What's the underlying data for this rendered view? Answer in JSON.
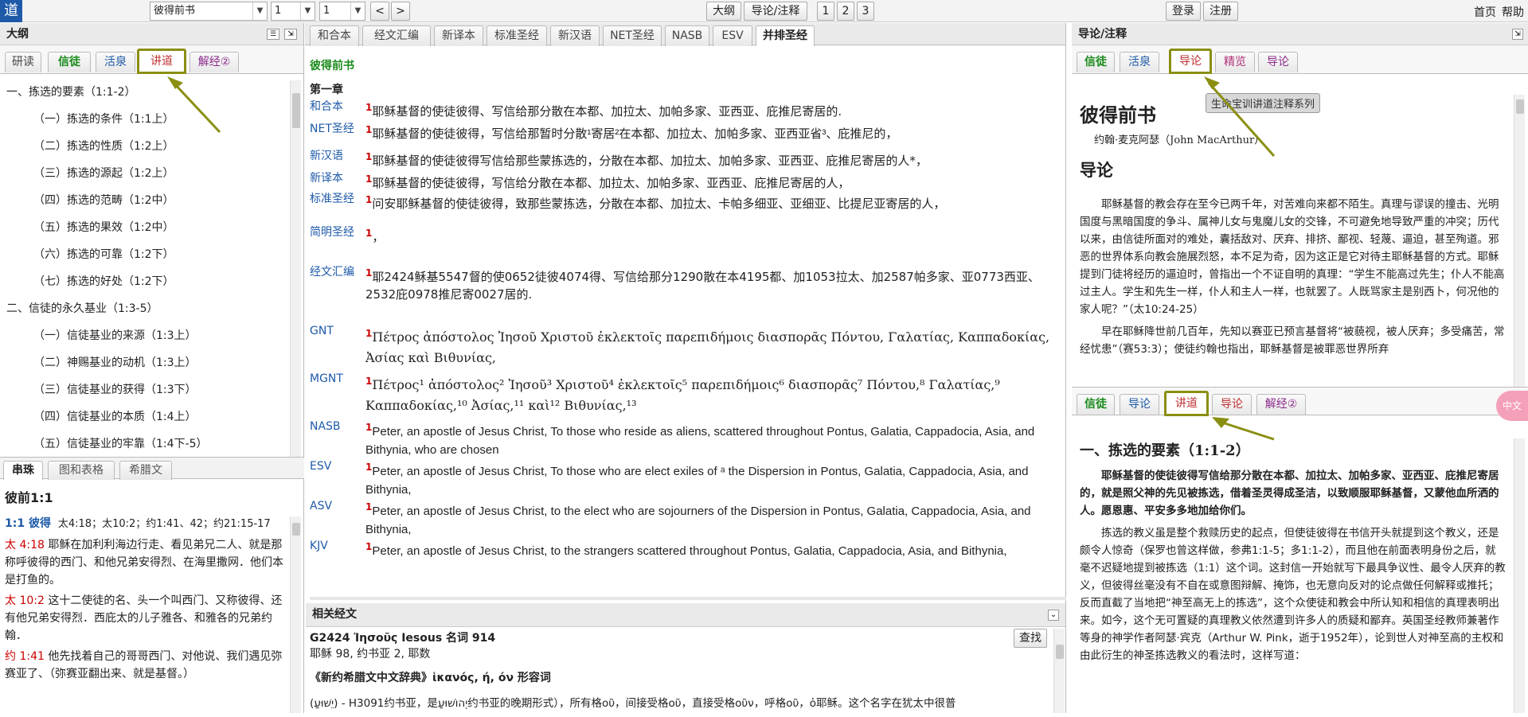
{
  "toolbar": {
    "logo": "道",
    "book": "彼得前书",
    "chapter": "1",
    "verse": "1",
    "prev": "<",
    "next": ">",
    "outline_btn": "大纲",
    "notes_btn": "导论/注释",
    "col1": "1",
    "col2": "2",
    "col3": "3",
    "login": "登录",
    "register": "注册",
    "home": "首页",
    "help": "帮助"
  },
  "left": {
    "title": "大纲",
    "tabs": [
      "研读",
      "信徒",
      "活泉",
      "讲道",
      "解经②"
    ],
    "outline": [
      "一、拣选的要素（1:1-2）",
      "（一）拣选的条件（1:1上）",
      "（二）拣选的性质（1:2上）",
      "（三）拣选的源起（1:2上）",
      "（四）拣选的范畴（1:2中）",
      "（五）拣选的果效（1:2中）",
      "（六）拣选的可靠（1:2下）",
      "（七）拣选的好处（1:2下）",
      "二、信徒的永久基业（1:3-5）",
      "（一）信徒基业的来源（1:3上）",
      "（二）神赐基业的动机（1:3上）",
      "（三）信徒基业的获得（1:3下）",
      "（四）信徒基业的本质（1:4上）",
      "（五）信徒基业的牢靠（1:4下-5）"
    ],
    "bottom_tabs": [
      "串珠",
      "图和表格",
      "希腊文"
    ],
    "cross_title": "彼前1:1",
    "cross_head_ref": "1:1 彼得",
    "cross_head_refs": "太4:18；太10:2；约1:41、42；约21:15-17",
    "cross_items": [
      {
        "ref": "太 4:18",
        "text": "耶稣在加利利海边行走、看见弟兄二人、就是那称呼彼得的西门、和他兄弟安得烈、在海里撒网．他们本是打鱼的。"
      },
      {
        "ref": "太 10:2",
        "text": "这十二使徒的名、头一个叫西门、又称彼得、还有他兄弟安得烈．西庇太的儿子雅各、和雅各的兄弟约翰．"
      },
      {
        "ref": "约 1:41",
        "text": "他先找着自己的哥哥西门、对他说、我们遇见弥赛亚了、（弥赛亚翻出来、就是基督。）"
      }
    ]
  },
  "center": {
    "tabs": [
      "和合本",
      "经文汇编",
      "新译本",
      "标准圣经",
      "新汉语",
      "NET圣经",
      "NASB",
      "ESV",
      "并排圣经"
    ],
    "book_title": "彼得前书",
    "chapter_title": "第一章",
    "verses": [
      {
        "name": "和合本",
        "text": "耶稣基督的使徒彼得、写信给那分散在本都、加拉太、加帕多家、亚西亚、庇推尼寄居的."
      },
      {
        "name": "NET圣经",
        "text": "耶稣基督的使徒彼得，写信给那暂时分散¹寄居²在本都、加拉太、加帕多家、亚西亚省³、庇推尼的，"
      },
      {
        "name": "新汉语",
        "text": "耶稣基督的使徒彼得写信给那些蒙拣选的，分散在本都、加拉太、加帕多家、亚西亚、庇推尼寄居的人*，"
      },
      {
        "name": "新译本",
        "text": "耶稣基督的使徒彼得，写信给分散在本都、加拉太、加帕多家、亚西亚、庇推尼寄居的人，"
      },
      {
        "name": "标准圣经",
        "text": "问安耶稣基督的使徒彼得，致那些蒙拣选，分散在本都、加拉太、卡帕多细亚、亚细亚、比提尼亚寄居的人，"
      },
      {
        "name": "简明圣经",
        "text": "，"
      },
      {
        "name": "经文汇编",
        "text": "耶2424稣基5547督的使0652徒彼4074得、写信给那分1290散在本4195都、加1053拉太、加2587帕多家、亚0773西亚、2532庇0978推尼寄0027居的."
      },
      {
        "name": "GNT",
        "text": "Πέτρος ἀπόστολος Ἰησοῦ Χριστοῦ ἐκλεκτοῖς παρεπιδήμοις διασπορᾶς Πόντου, Γαλατίας, Καππαδοκίας, Ἀσίας καὶ Βιθυνίας,"
      },
      {
        "name": "MGNT",
        "text": "Πέτρος¹ ἀπόστολος² Ἰησοῦ³ Χριστοῦ⁴ ἐκλεκτοῖς⁵ παρεπιδήμοις⁶ διασπορᾶς⁷ Πόντου,⁸ Γαλατίας,⁹ Καππαδοκίας,¹⁰ Ἀσίας,¹¹ καὶ¹² Βιθυνίας,¹³"
      },
      {
        "name": "NASB",
        "text": "Peter, an apostle of Jesus Christ, To those who reside as aliens, scattered throughout Pontus, Galatia, Cappadocia, Asia, and Bithynia, who are chosen"
      },
      {
        "name": "ESV",
        "text": "Peter, an apostle of Jesus Christ, To those who are elect exiles of ᵃ the Dispersion in Pontus, Galatia, Cappadocia, Asia, and Bithynia,"
      },
      {
        "name": "ASV",
        "text": "Peter, an apostle of Jesus Christ, to the elect who are sojourners of the Dispersion in Pontus, Galatia, Cappadocia, Asia, and Bithynia,"
      },
      {
        "name": "KJV",
        "text": "Peter, an apostle of Jesus Christ, to the strangers scattered throughout Pontus, Galatia, Cappadocia, Asia, and Bithynia,"
      }
    ],
    "verse_num": "1",
    "related_title": "相关经文",
    "strong_line": "G2424 Ἰησοῦς Iesous 名词 914",
    "strong_sub": "耶稣 98, 约书亚 2, 耶数",
    "search_btn": "查找",
    "dict_line": "《新约希腊文中文辞典》ἱκανός, ή, όν 形容词",
    "dict_text": "(יֵשׁוּעַ) - H3091约书亚，是יְהוֹשׁוּעַ约书亚的晚期形式），所有格οῦ，间接受格οῦ，直接受格οῦν，呼格οῦ，ὁ耶稣。这个名字在犹太中很普"
  },
  "right": {
    "title": "导论/注释",
    "top_tabs": [
      "信徒",
      "活泉",
      "导论",
      "精览",
      "导论"
    ],
    "tooltip": "生命宝训讲道注释系列",
    "doc_title": "彼得前书",
    "author": "约翰·麦克阿瑟（John MacArthur）",
    "intro_heading": "导论",
    "intro_p1": "耶稣基督的教会存在至今已两千年，对苦难向来都不陌生。真理与谬误的撞击、光明国度与黑暗国度的争斗、属神儿女与鬼魔儿女的交锋，不可避免地导致严重的冲突；历代以来，由信徒所面对的难处，囊括敌对、厌弃、排挤、鄙视、轻蔑、逼迫，甚至殉道。邪恶的世界体系向教会施展烈怒，本不足为奇，因为这正是它对待主耶稣基督的方式。耶稣提到门徒将经历的逼迫时，曾指出一个不证自明的真理：“学生不能高过先生；仆人不能高过主人。学生和先生一样，仆人和主人一样，也就罢了。人既骂家主是别西卜，何况他的家人呢？”（太10:24-25）",
    "intro_p2": "早在耶稣降世前几百年，先知以赛亚已预言基督将“被藐视，被人厌弃；多受痛苦，常经忧患”（赛53:3）；使徒约翰也指出，耶稣基督是被罪恶世界所弃",
    "bottom_tabs": [
      "信徒",
      "导论",
      "讲道",
      "导论",
      "解经②"
    ],
    "sermon_heading": "一、拣选的要素（1:1-2）",
    "sermon_bold": "耶稣基督的使徒彼得写信给那分散在本都、加拉太、加帕多家、亚西亚、庇推尼寄居的，就是照父神的先见被拣选，借着圣灵得成圣洁，以致顺服耶稣基督，又蒙他血所洒的人。愿恩惠、平安多多地加给你们。",
    "sermon_p": "拣选的教义虽是整个救赎历史的起点，但使徒彼得在书信开头就提到这个教义，还是颇令人惊奇（保罗也曾这样做，参弗1:1-5；多1:1-2），而且他在前面表明身份之后，就毫不迟疑地提到被拣选（1:1）这个词。这封信一开始就写下最具争议性、最令人厌弃的教义，但彼得丝毫没有不自在或意图辩解、掩饰，也无意向反对的论点做任何解释或推托；反而直截了当地把“神至高无上的拣选”，这个众使徒和教会中所认知和相信的真理表明出来。如今，这个无可置疑的真理教义依然遭到许多人的质疑和鄙弃。英国圣经教师兼著作等身的神学作者阿瑟·宾克（Arthur W. Pink，逝于1952年），论到世人对神至高的主权和由此衍生的神圣拣选教义的看法时，这样写道：",
    "float_btn": "中文"
  },
  "colors": {
    "accent": "#1e5aa8",
    "highlight": "#8a8f12",
    "verse_num": "#cc0000",
    "strong": "#a03030",
    "green_tab": "#1a8a1a",
    "purple_tab": "#8a2a8a",
    "red_tab": "#c03030"
  }
}
